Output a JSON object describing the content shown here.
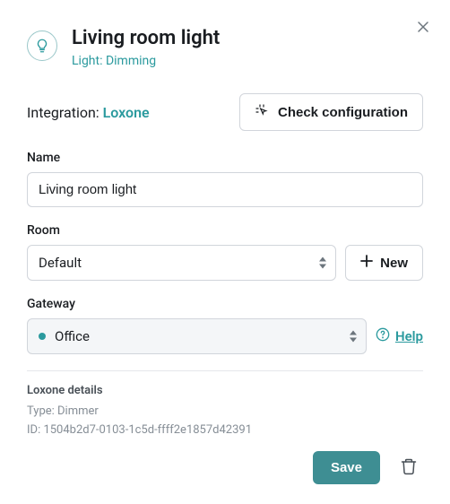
{
  "header": {
    "title": "Living room light",
    "subtype": "Light: Dimming"
  },
  "integration": {
    "prefix": "Integration: ",
    "name": "Loxone",
    "check_label": "Check configuration"
  },
  "fields": {
    "name": {
      "label": "Name",
      "value": "Living room light"
    },
    "room": {
      "label": "Room",
      "selected": "Default",
      "new_label": "New"
    },
    "gateway": {
      "label": "Gateway",
      "selected": "Office",
      "help_label": "Help"
    }
  },
  "details": {
    "title": "Loxone details",
    "type_line": "Type: Dimmer",
    "id_line": "ID: 1504b2d7-0103-1c5d-ffff2e1857d42391"
  },
  "footer": {
    "save_label": "Save"
  }
}
